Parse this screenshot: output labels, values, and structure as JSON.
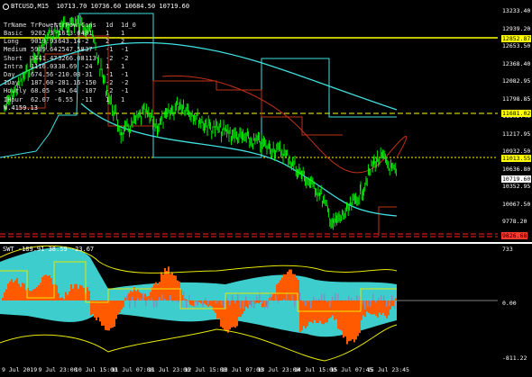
{
  "header": {
    "symbol": "BTCUSD,M15",
    "prices": "10713.70 10736.60 10684.50 10719.60"
  },
  "table": {
    "headers": [
      "TrName",
      "TrPower",
      "%trPow",
      "Cons",
      "1d",
      "1d_0"
    ],
    "rows": [
      [
        "Basic",
        "9202.3",
        "-1613.64",
        "-81",
        "1",
        "1"
      ],
      [
        "Long",
        "9019.93",
        "-643.14",
        "-2",
        "2",
        "2"
      ],
      [
        "Medium",
        "5909.64",
        "-2547.58",
        "-37",
        "-1",
        "-1"
      ],
      [
        "Short",
        "3441.47",
        "-3266.08",
        "-113",
        "-2",
        "-2"
      ],
      [
        "Intra",
        "1116.03",
        "-38.69",
        "-24",
        "1",
        "1"
      ],
      [
        "Day",
        "674.56",
        "-210.08",
        "-31",
        "-1",
        "-1"
      ],
      [
        "IDay",
        "187.60",
        "-281.16",
        "-150",
        "-2",
        "-2"
      ],
      [
        "Hourly",
        "68.05",
        "-94.64",
        "-107",
        "-2",
        "-1"
      ],
      [
        "IHour",
        "62.07",
        "-6.55",
        "-11",
        "1",
        "1"
      ]
    ],
    "extra": "W.4159.13"
  },
  "main_axis": {
    "ticks": [
      "13233.40",
      "12939.20",
      "12653.50",
      "12368.40",
      "12082.95",
      "11798.85",
      "11502.40",
      "11217.95",
      "10932.50",
      "10636.80",
      "10352.95",
      "10067.50",
      "9778.20"
    ],
    "labels": [
      {
        "text": "12852.87",
        "bg": "#ffff00"
      },
      {
        "text": "11681.02",
        "bg": "#ffff00"
      },
      {
        "text": "11013.55",
        "bg": "#ffff00"
      },
      {
        "text": "10719.60",
        "bg": "#ffffff"
      },
      {
        "text": "9826.68",
        "bg": "#ff3b2f"
      }
    ]
  },
  "sub_indicator": {
    "label": "SWT -189.91 38.59 -23.67",
    "ticks": [
      "733",
      "0.00",
      "-811.22"
    ]
  },
  "x_axis": {
    "ticks": [
      "9 Jul 2019",
      "9 Jul 23:00",
      "10 Jul 15:00",
      "11 Jul 07:00",
      "11 Jul 23:00",
      "12 Jul 15:00",
      "13 Jul 07:00",
      "13 Jul 23:00",
      "14 Jul 15:00",
      "15 Jul 07:45",
      "15 Jul 23:45"
    ]
  },
  "colors": {
    "price": "#00ff00",
    "ma_cyan": "#40e0e0",
    "ma_red": "#c03018",
    "level_yellow": "#ffff00",
    "level_red": "#ff2020",
    "hist_orange": "#ff5a00",
    "hist_cyan": "#40d8d8",
    "band_yellow": "#e8e800"
  }
}
